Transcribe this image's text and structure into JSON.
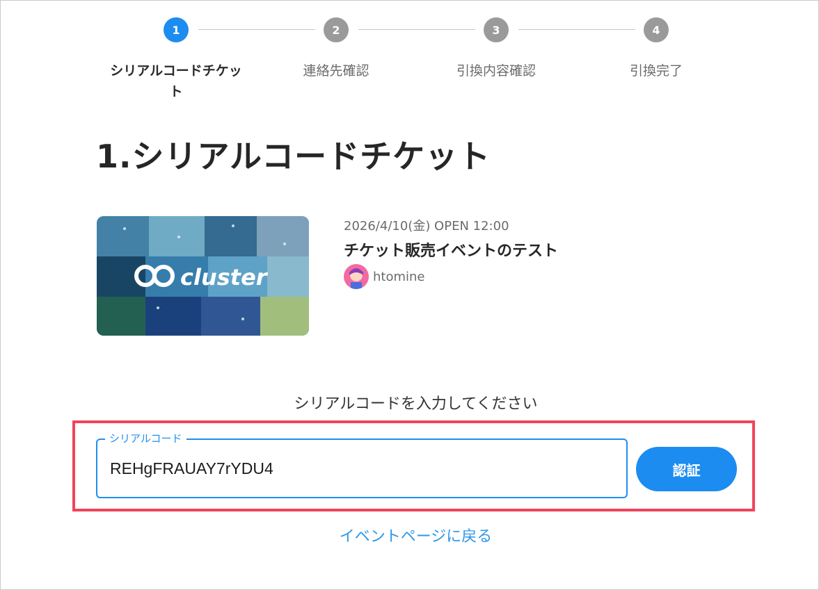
{
  "stepper": {
    "steps": [
      {
        "number": "1",
        "label": "シリアルコードチケット",
        "state": "active"
      },
      {
        "number": "2",
        "label": "連絡先確認",
        "state": "inactive"
      },
      {
        "number": "3",
        "label": "引換内容確認",
        "state": "inactive"
      },
      {
        "number": "4",
        "label": "引換完了",
        "state": "inactive"
      }
    ]
  },
  "page": {
    "title": "1.シリアルコードチケット"
  },
  "event": {
    "thumbnail_icon": "cluster-banner-image",
    "thumbnail_text": "cluster",
    "date": "2026/4/10(金)  OPEN 12:00",
    "title": "チケット販売イベントのテスト",
    "host_name": "htomine"
  },
  "serial_form": {
    "prompt": "シリアルコードを入力してください",
    "field_label": "シリアルコード",
    "field_value": "REHgFRAUAY7rYDU4",
    "verify_label": "認証"
  },
  "back_link": "イベントページに戻る",
  "colors": {
    "accent": "#1c8cf0",
    "highlight": "#f0445c",
    "inactive_step": "#9a9a9a"
  }
}
